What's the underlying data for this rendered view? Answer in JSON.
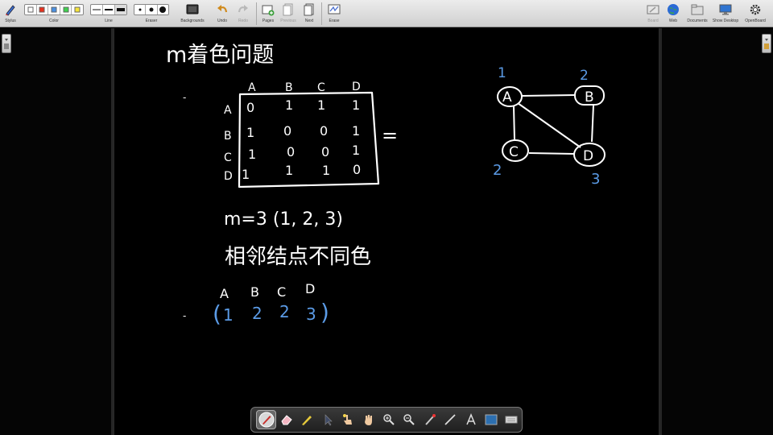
{
  "toolbar": {
    "stylus_label": "Stylus",
    "color_label": "Color",
    "line_label": "Line",
    "eraser_label": "Eraser",
    "backgrounds_label": "Backgrounds",
    "undo_label": "Undo",
    "redo_label": "Redo",
    "pages_label": "Pages",
    "previous_label": "Previous",
    "next_label": "Next",
    "erase_label": "Erase",
    "board_label": "Board",
    "web_label": "Web",
    "documents_label": "Documents",
    "show_desktop_label": "Show Desktop",
    "openboard_label": "OpenBoard",
    "colors": [
      "#ffffff",
      "#e8301c",
      "#4a90e2",
      "#3fd14f",
      "#f5e43a"
    ]
  },
  "board": {
    "title": "m着色问题",
    "col_headers": [
      "A",
      "B",
      "C",
      "D"
    ],
    "row_headers": [
      "A",
      "B",
      "C",
      "D"
    ],
    "matrix": [
      [
        "0",
        "1",
        "1",
        "1"
      ],
      [
        "1",
        "0",
        "0",
        "1"
      ],
      [
        "1",
        "0",
        "0",
        "1"
      ],
      [
        "1",
        "1",
        "1",
        "0"
      ]
    ],
    "equals": "=",
    "m_line": "m=3  (1, 2, 3)",
    "rule_line": "相邻结点不同色",
    "answer_headers": [
      "A",
      "B",
      "C",
      "D"
    ],
    "answer_values": [
      "1",
      "2",
      "2",
      "3"
    ],
    "answer_open": "(",
    "answer_close": ")",
    "bullet": "-",
    "graph": {
      "nodes": [
        {
          "id": "A",
          "color_num": "1"
        },
        {
          "id": "B",
          "color_num": "2"
        },
        {
          "id": "C",
          "color_num": "2"
        },
        {
          "id": "D",
          "color_num": "3"
        }
      ],
      "edges": [
        [
          "A",
          "B"
        ],
        [
          "A",
          "C"
        ],
        [
          "A",
          "D"
        ],
        [
          "B",
          "D"
        ],
        [
          "C",
          "D"
        ]
      ]
    },
    "ink_color": "#ffffff",
    "answer_ink_color": "#5b9be6"
  },
  "dock": {
    "tools": [
      "pen-tool",
      "eraser-tool",
      "marker-tool",
      "selector-tool",
      "interact-tool",
      "hand-tool",
      "zoom-in-tool",
      "zoom-out-tool",
      "laser-pointer-tool",
      "line-tool",
      "text-tool",
      "capture-tool",
      "virtual-keyboard-tool"
    ]
  }
}
